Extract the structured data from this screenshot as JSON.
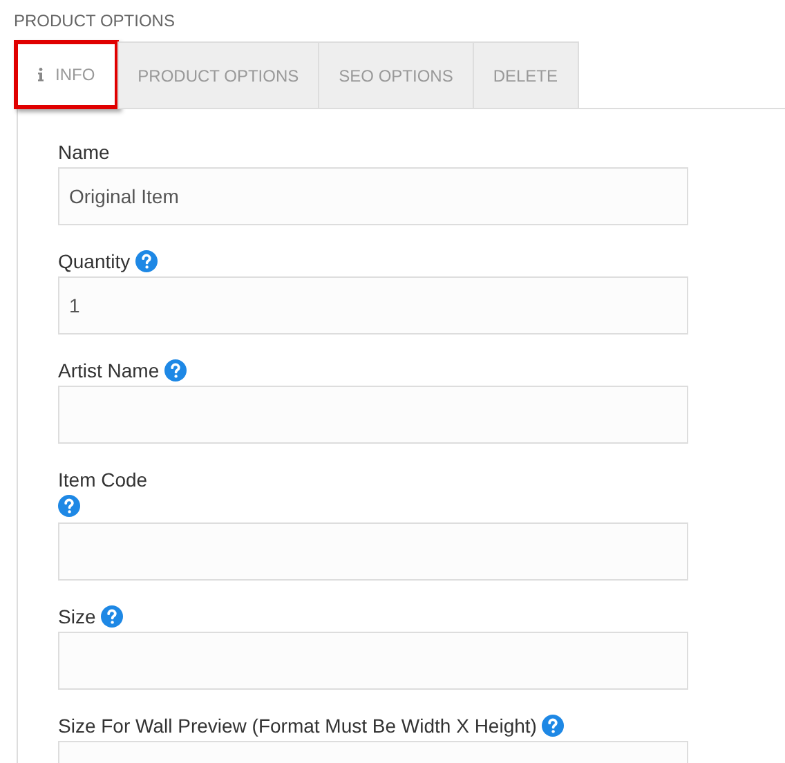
{
  "heading": "PRODUCT OPTIONS",
  "tabs": [
    {
      "label": "INFO",
      "selected": true,
      "highlighted": true,
      "has_icon": true
    },
    {
      "label": "PRODUCT OPTIONS",
      "selected": false,
      "highlighted": false,
      "has_icon": false
    },
    {
      "label": "SEO OPTIONS",
      "selected": false,
      "highlighted": false,
      "has_icon": false
    },
    {
      "label": "DELETE",
      "selected": false,
      "highlighted": false,
      "has_icon": false
    }
  ],
  "fields": [
    {
      "label": "Name",
      "value": "Original Item",
      "help": false
    },
    {
      "label": "Quantity",
      "value": "1",
      "help": true,
      "help_below": false
    },
    {
      "label": "Artist Name",
      "help": true,
      "help_below": false
    },
    {
      "label": "Item Code",
      "help": true,
      "help_below": true
    },
    {
      "label": "Size",
      "help": true,
      "help_below": false
    },
    {
      "label": "Size For Wall Preview (Format Must Be Width X Height)",
      "help": true,
      "help_below": false
    }
  ]
}
